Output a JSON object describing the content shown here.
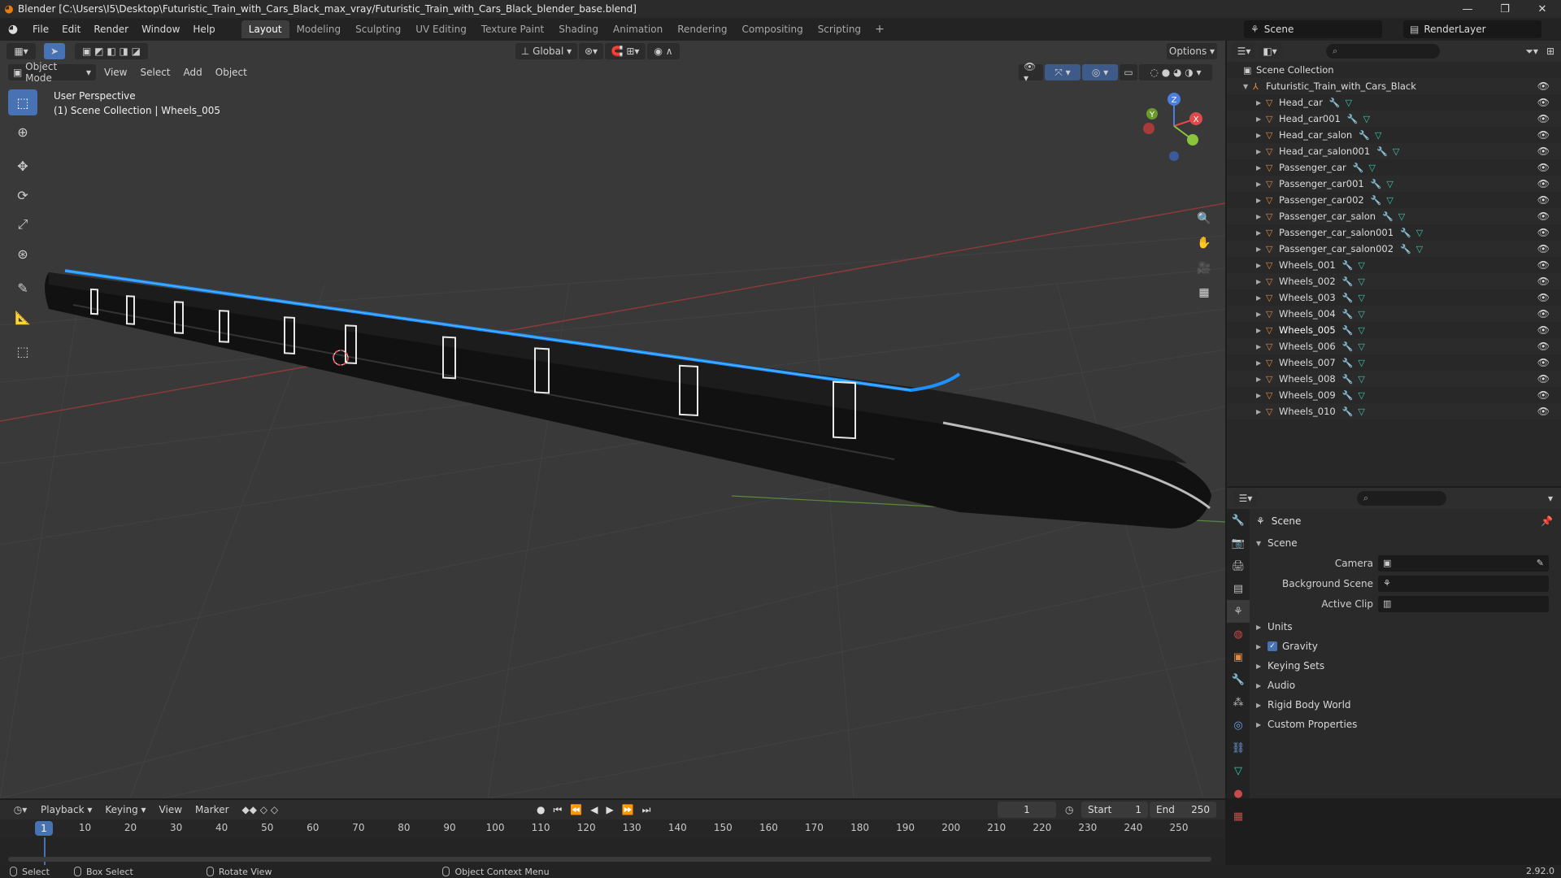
{
  "titlebar": {
    "title": "Blender [C:\\Users\\I5\\Desktop\\Futuristic_Train_with_Cars_Black_max_vray/Futuristic_Train_with_Cars_Black_blender_base.blend]",
    "minimize": "—",
    "maximize": "❐",
    "close": "✕"
  },
  "menu": [
    "File",
    "Edit",
    "Render",
    "Window",
    "Help"
  ],
  "workspaces": [
    "Layout",
    "Modeling",
    "Sculpting",
    "UV Editing",
    "Texture Paint",
    "Shading",
    "Animation",
    "Rendering",
    "Compositing",
    "Scripting"
  ],
  "active_workspace": "Layout",
  "scene_name": "Scene",
  "render_layer": "RenderLayer",
  "viewport": {
    "mode": "Object Mode",
    "header_menus": [
      "View",
      "Select",
      "Add",
      "Object"
    ],
    "transform_orientation": "Global",
    "options_label": "Options",
    "perspective": "User Perspective",
    "collection_info": "(1) Scene Collection | Wheels_005"
  },
  "gizmo": {
    "z_label": "Z",
    "x_label": "X",
    "y_label": "Y"
  },
  "outliner": {
    "root": "Scene Collection",
    "collection": "Futuristic_Train_with_Cars_Black",
    "objects": [
      "Head_car",
      "Head_car001",
      "Head_car_salon",
      "Head_car_salon001",
      "Passenger_car",
      "Passenger_car001",
      "Passenger_car002",
      "Passenger_car_salon",
      "Passenger_car_salon001",
      "Passenger_car_salon002",
      "Wheels_001",
      "Wheels_002",
      "Wheels_003",
      "Wheels_004",
      "Wheels_005",
      "Wheels_006",
      "Wheels_007",
      "Wheels_008",
      "Wheels_009",
      "Wheels_010"
    ],
    "selected": "Wheels_005"
  },
  "properties": {
    "context": "Scene",
    "panel": "Scene",
    "fields": [
      {
        "label": "Camera",
        "value": ""
      },
      {
        "label": "Background Scene",
        "value": ""
      },
      {
        "label": "Active Clip",
        "value": ""
      }
    ],
    "subpanels": [
      "Units",
      "Gravity",
      "Keying Sets",
      "Audio",
      "Rigid Body World",
      "Custom Properties"
    ],
    "gravity_checked": true
  },
  "timeline": {
    "menus": [
      "Playback",
      "Keying",
      "View",
      "Marker"
    ],
    "current_frame": "1",
    "start_label": "Start",
    "start": "1",
    "end_label": "End",
    "end": "250",
    "ticks": [
      "10",
      "20",
      "30",
      "40",
      "50",
      "60",
      "70",
      "80",
      "90",
      "100",
      "110",
      "120",
      "130",
      "140",
      "150",
      "160",
      "170",
      "180",
      "190",
      "200",
      "210",
      "220",
      "230",
      "240",
      "250"
    ]
  },
  "statusbar": {
    "select": "Select",
    "box_select": "Box Select",
    "rotate_view": "Rotate View",
    "context_menu": "Object Context Menu",
    "version": "2.92.0"
  },
  "colors": {
    "accent": "#4772b3",
    "object_orange": "#e8883a",
    "mesh_green": "#37c8a8",
    "train_glow": "#1e90ff"
  }
}
